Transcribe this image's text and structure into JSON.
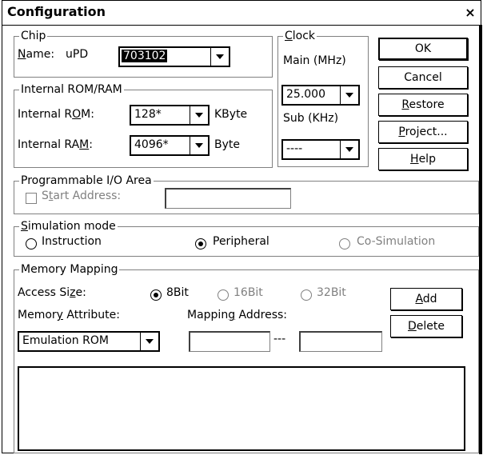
{
  "window": {
    "title": "Configuration",
    "close_glyph": "×"
  },
  "chip": {
    "legend": "Chip",
    "name_label_u": "N",
    "name_label_rest": "ame:",
    "name_prefix": "uPD",
    "name_value": "703102"
  },
  "clock": {
    "legend_u": "C",
    "legend_rest": "lock",
    "main_label": "Main (MHz)",
    "main_value": "25.000",
    "sub_label": "Sub (KHz)",
    "sub_value": "----"
  },
  "buttons": {
    "ok": "OK",
    "cancel": "Cancel",
    "restore_u": "R",
    "restore_rest": "estore",
    "project_u": "P",
    "project_rest": "roject...",
    "help_u": "H",
    "help_rest": "elp"
  },
  "rom_ram": {
    "legend": "Internal ROM/RAM",
    "rom_label_pre": "Internal R",
    "rom_label_u": "O",
    "rom_label_post": "M:",
    "rom_value": "128*",
    "rom_unit": "KByte",
    "ram_label_pre": "Internal RA",
    "ram_label_u": "M",
    "ram_label_post": ":",
    "ram_value": "4096*",
    "ram_unit": "Byte"
  },
  "pio": {
    "legend": "Programmable I/O Area",
    "start_pre": "S",
    "start_u": "t",
    "start_post": "art Address:",
    "checked": false
  },
  "simulation": {
    "legend_u": "S",
    "legend_rest": "imulation mode",
    "options": [
      "Instruction",
      "Peripheral",
      "Co-Simulation"
    ],
    "selected": "Peripheral"
  },
  "memory": {
    "legend": "Memory Mapping",
    "access_pre": "Access Si",
    "access_u": "z",
    "access_post": "e:",
    "sizes": [
      "8Bit",
      "16Bit",
      "32Bit"
    ],
    "selected_size": "8Bit",
    "attr_pre": "Memor",
    "attr_u": "y",
    "attr_post": " Attribute:",
    "attr_value": "Emulation ROM",
    "map_pre": "Mappin",
    "map_u": "g",
    "map_post": " Address:",
    "range_sep": "---",
    "add_u": "A",
    "add_rest": "dd",
    "delete_u": "D",
    "delete_rest": "elete"
  }
}
